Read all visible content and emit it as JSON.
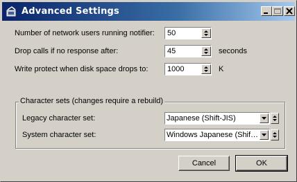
{
  "window": {
    "title": "Advanced Settings",
    "icon": "app-icon"
  },
  "titlebar_buttons": {
    "minimize_icon": "minimize-icon",
    "maximize_icon": "maximize-icon",
    "close_icon": "close-icon"
  },
  "fields": {
    "network_users": {
      "label": "Number of network users running notifier:",
      "value": "50"
    },
    "drop_calls": {
      "label": "Drop calls if no response after:",
      "value": "45",
      "unit": "seconds"
    },
    "write_protect": {
      "label": "Write protect when disk space drops to:",
      "value": "1000",
      "unit": "K"
    }
  },
  "charsets": {
    "group_label": "Character sets (changes require a rebuild)",
    "legacy": {
      "label": "Legacy character set:",
      "value": "Japanese (Shift-JIS)"
    },
    "system": {
      "label": "System character set:",
      "value": "Windows Japanese (Shif…"
    }
  },
  "buttons": {
    "cancel": "Cancel",
    "ok": "OK"
  }
}
